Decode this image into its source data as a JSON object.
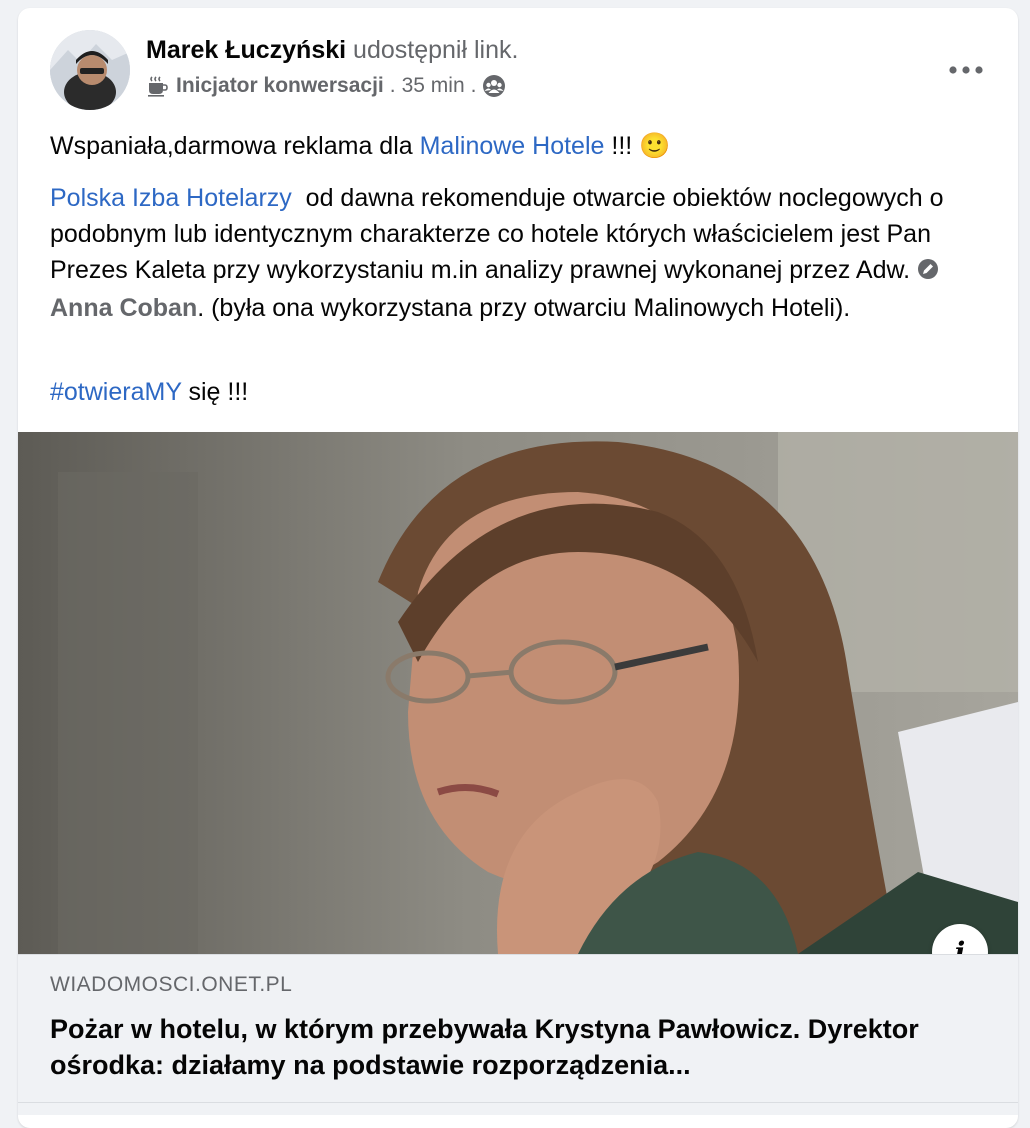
{
  "post": {
    "author": "Marek Łuczyński",
    "action": "udostępnił link.",
    "badge_icon": "coffee-cup-icon",
    "badge_label": "Inicjator konwersacji",
    "separator": ".",
    "time": "35 min",
    "audience_icon": "group-icon",
    "more_icon": "ellipsis-icon"
  },
  "body": {
    "line1_prefix": "Wspaniała,darmowa reklama dla ",
    "line1_link": "Malinowe Hotele",
    "line1_suffix": " !!! ",
    "emoji": "🙂",
    "p2_link": "Polska Izba Hotelarzy",
    "p2_text_a": "  od dawna rekomenduje otwarcie obiektów noclegowych o podobnym lub identycznym charakterze co hotele których właścicielem jest Pan Prezes Kaleta przy wykorzystaniu m.in analizy prawnej wykonanej przez Adw. ",
    "p2_mention": "Anna Coban",
    "p2_text_b": ". (była ona wykorzystana przy otwarciu Malinowych Hoteli).",
    "hashtag": "#otwieraMY",
    "hashtag_suffix": " się !!!"
  },
  "link_preview": {
    "domain": "WIADOMOSCI.ONET.PL",
    "headline": "Pożar w hotelu, w którym przebywała Krystyna Pawłowicz. Dyrektor ośrodka: działamy na podstawie rozporządzenia...",
    "info_label": "i"
  },
  "colors": {
    "link": "#2d68c4",
    "secondary_text": "#65676b",
    "card_bg": "#ffffff",
    "preview_bg": "#f0f2f5"
  }
}
